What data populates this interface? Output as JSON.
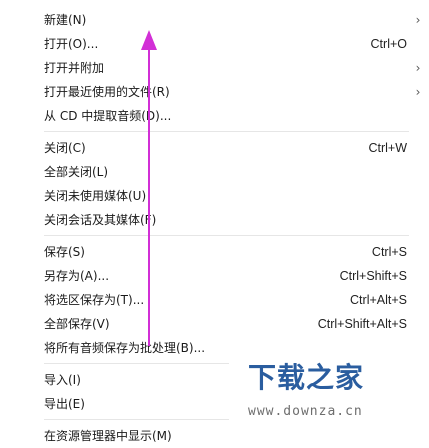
{
  "menu": {
    "items": [
      {
        "label": "新建(N)",
        "shortcut": "",
        "submenu": true
      },
      {
        "label": "打开(O)...",
        "shortcut": "Ctrl+O",
        "submenu": false
      },
      {
        "label": "打开并附加",
        "shortcut": "",
        "submenu": true
      },
      {
        "label": "打开最近使用的文件(R)",
        "shortcut": "",
        "submenu": true
      },
      {
        "label": "从 CD 中提取音频(D)...",
        "shortcut": "",
        "submenu": false
      },
      {
        "label": "关闭(C)",
        "shortcut": "Ctrl+W",
        "submenu": false
      },
      {
        "label": "全部关闭(L)",
        "shortcut": "",
        "submenu": false
      },
      {
        "label": "关闭未使用媒体(U)",
        "shortcut": "",
        "submenu": false
      },
      {
        "label": "关闭会话及其媒体(F)",
        "shortcut": "",
        "submenu": false
      },
      {
        "label": "保存(S)",
        "shortcut": "Ctrl+S",
        "submenu": false
      },
      {
        "label": "另存为(A)...",
        "shortcut": "Ctrl+Shift+S",
        "submenu": false
      },
      {
        "label": "将选区保存为(T)...",
        "shortcut": "Ctrl+Alt+S",
        "submenu": false
      },
      {
        "label": "全部保存(V)",
        "shortcut": "Ctrl+Shift+Alt+S",
        "submenu": false
      },
      {
        "label": "将所有音频保存为批处理(B)...",
        "shortcut": "",
        "submenu": false
      },
      {
        "label": "导入(I)",
        "shortcut": "",
        "submenu": false
      },
      {
        "label": "导出(E)",
        "shortcut": "",
        "submenu": false
      },
      {
        "label": "在资源管理器中显示(M)",
        "shortcut": "",
        "submenu": false
      }
    ]
  },
  "watermark": {
    "logo_text": "下载之家",
    "url": "www.downza.cn"
  },
  "colors": {
    "annotation_arrow": "#d22fd6",
    "logo": "#2a5d9f"
  }
}
